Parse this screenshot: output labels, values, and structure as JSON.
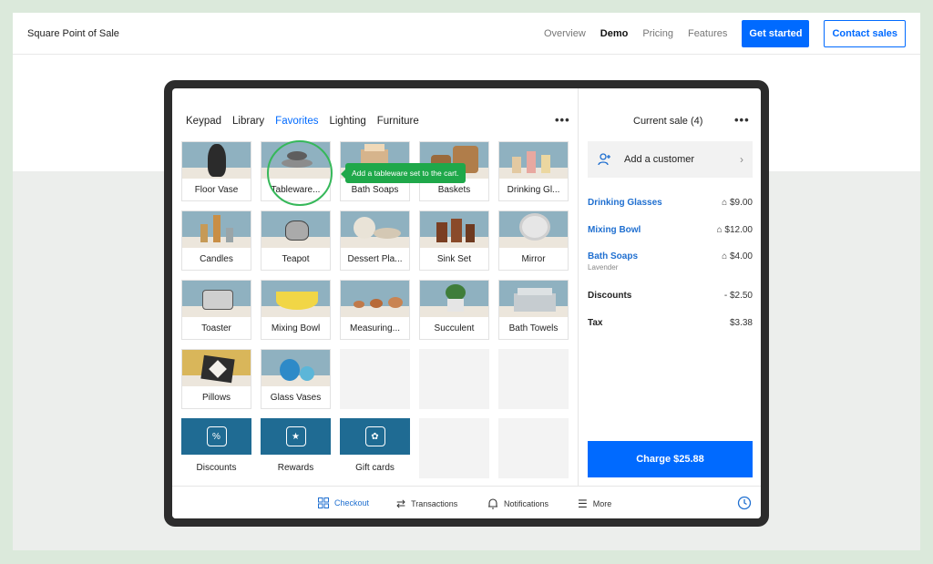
{
  "navbar": {
    "brand": "Square Point of Sale",
    "links": [
      "Overview",
      "Demo",
      "Pricing",
      "Features"
    ],
    "get_started": "Get started",
    "contact_sales": "Contact sales"
  },
  "tabs": [
    "Keypad",
    "Library",
    "Favorites",
    "Lighting",
    "Furniture"
  ],
  "tiles": [
    "Floor Vase",
    "Tableware...",
    "Bath Soaps",
    "Baskets",
    "Drinking Gl...",
    "Candles",
    "Teapot",
    "Dessert Pla...",
    "Sink Set",
    "Mirror",
    "Toaster",
    "Mixing Bowl",
    "Measuring...",
    "Succulent",
    "Bath Towels",
    "Pillows",
    "Glass Vases",
    "Discounts",
    "Rewards",
    "Gift cards"
  ],
  "tooltip": "Add a tableware set to the cart.",
  "cart": {
    "title": "Current sale (4)",
    "add_customer": "Add a customer",
    "items": [
      {
        "name": "Drinking Glasses",
        "price": "$9.00"
      },
      {
        "name": "Mixing Bowl",
        "price": "$12.00"
      },
      {
        "name": "Bath Soaps",
        "price": "$4.00",
        "sub": "Lavender"
      }
    ],
    "discounts_label": "Discounts",
    "discounts_value": "- $2.50",
    "tax_label": "Tax",
    "tax_value": "$3.38",
    "charge": "Charge $25.88"
  },
  "bottom_nav": [
    "Checkout",
    "Transactions",
    "Notifications",
    "More"
  ]
}
